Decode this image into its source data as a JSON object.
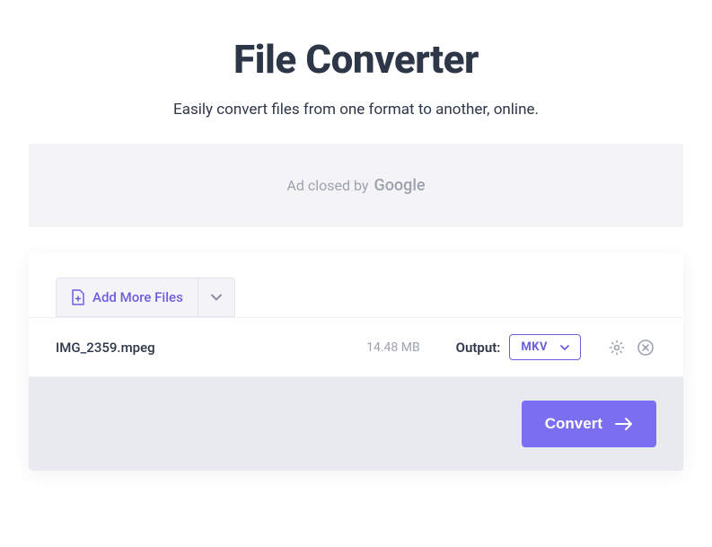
{
  "header": {
    "title": "File Converter",
    "subtitle": "Easily convert files from one format to another, online."
  },
  "ad": {
    "text": "Ad closed by",
    "brand": "Google"
  },
  "toolbar": {
    "add_more_label": "Add More Files"
  },
  "file": {
    "name": "IMG_2359.mpeg",
    "size": "14.48 MB",
    "output_label": "Output:",
    "format": "MKV"
  },
  "actions": {
    "convert_label": "Convert"
  }
}
